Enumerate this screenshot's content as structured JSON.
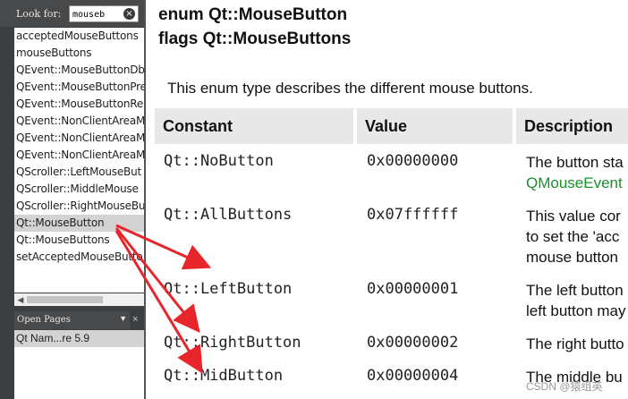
{
  "sidebar": {
    "lookfor_label": "Look for:",
    "search_value": "mouseb",
    "clear_icon": "clear-icon",
    "index_items": [
      {
        "label": "acceptedMouseButtons"
      },
      {
        "label": "mouseButtons"
      },
      {
        "label": "QEvent::MouseButtonDbl"
      },
      {
        "label": "QEvent::MouseButtonPre"
      },
      {
        "label": "QEvent::MouseButtonRel"
      },
      {
        "label": "QEvent::NonClientAreaM"
      },
      {
        "label": "QEvent::NonClientAreaM"
      },
      {
        "label": "QEvent::NonClientAreaM"
      },
      {
        "label": "QScroller::LeftMouseBut"
      },
      {
        "label": "QScroller::MiddleMouse"
      },
      {
        "label": "QScroller::RightMouseBu"
      },
      {
        "label": "Qt::MouseButton"
      },
      {
        "label": "Qt::MouseButtons"
      },
      {
        "label": "setAcceptedMouseButto"
      }
    ],
    "selected_index": 11,
    "open_pages_label": "Open Pages",
    "open_pages_close": "×",
    "open_pages": [
      {
        "label": "Qt Nam...re 5.9"
      }
    ]
  },
  "content": {
    "title_enum": "enum Qt::MouseButton",
    "title_flags": "flags Qt::MouseButtons",
    "description": "This enum type describes the different mouse buttons.",
    "table": {
      "headers": [
        "Constant",
        "Value",
        "Description"
      ],
      "rows": [
        {
          "constant": "Qt::NoButton",
          "value": "0x00000000",
          "desc_line1": "The button sta",
          "desc_line2": "QMouseEvent",
          "desc_line3": ""
        },
        {
          "constant": "Qt::AllButtons",
          "value": "0x07ffffff",
          "desc_line1": "This value cor",
          "desc_line2": "to set the 'acc",
          "desc_line3": "mouse button"
        },
        {
          "constant": "Qt::LeftButton",
          "value": "0x00000001",
          "desc_line1": "The left button",
          "desc_line2": "left button may",
          "desc_line3": ""
        },
        {
          "constant": "Qt::RightButton",
          "value": "0x00000002",
          "desc_line1": "The right butto",
          "desc_line2": "",
          "desc_line3": ""
        },
        {
          "constant": "Qt::MidButton",
          "value": "0x00000004",
          "desc_line1": "The middle bu",
          "desc_line2": "",
          "desc_line3": ""
        }
      ]
    }
  },
  "annotation": {
    "arrow_color": "#e8252b"
  },
  "watermark": "CSDN @猿组英"
}
